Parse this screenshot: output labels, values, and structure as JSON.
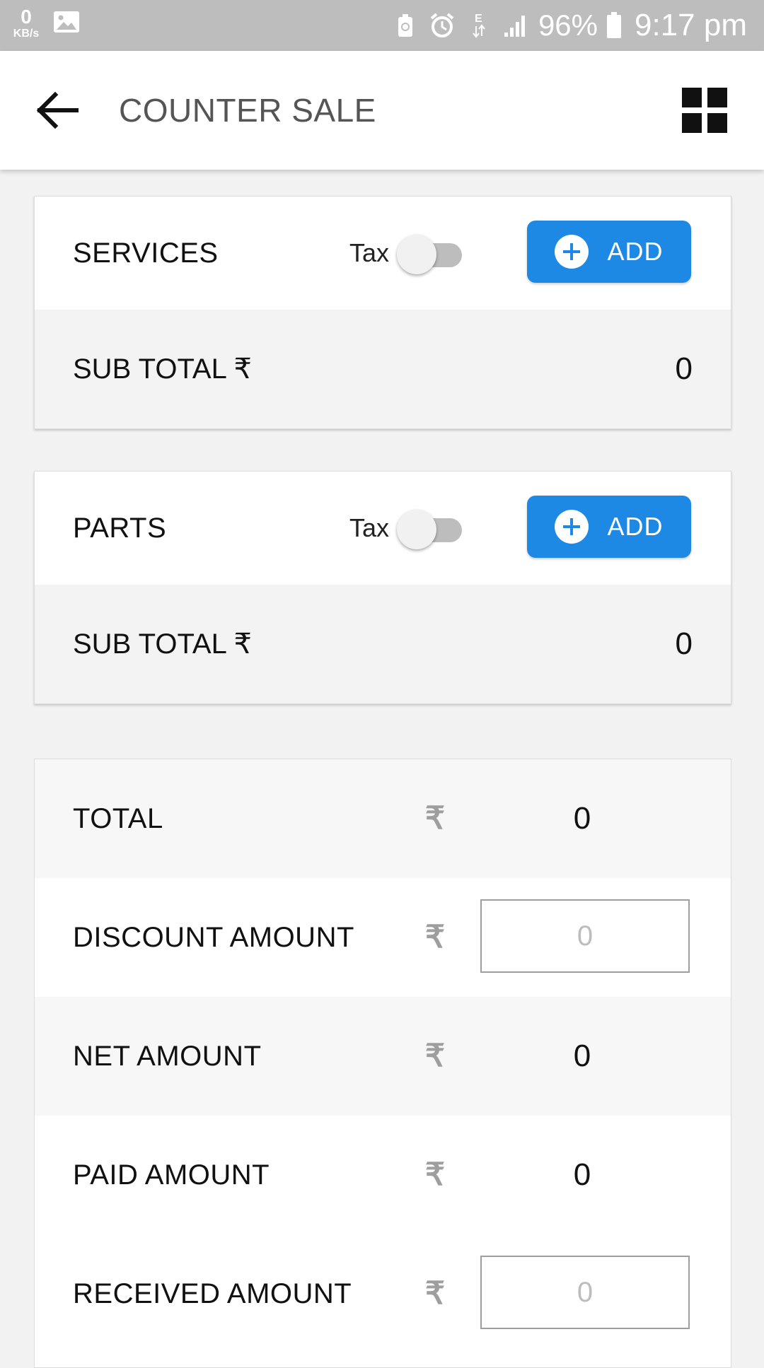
{
  "status_bar": {
    "kbps_value": "0",
    "kbps_unit": "KB/s",
    "battery_percent": "96%",
    "time": "9:17 pm"
  },
  "app_bar": {
    "title": "COUNTER SALE"
  },
  "services_card": {
    "title": "SERVICES",
    "tax_label": "Tax",
    "tax_enabled": false,
    "add_label": "ADD",
    "subtotal_label": "SUB TOTAL ₹",
    "subtotal_value": "0"
  },
  "parts_card": {
    "title": "PARTS",
    "tax_label": "Tax",
    "tax_enabled": false,
    "add_label": "ADD",
    "subtotal_label": "SUB TOTAL ₹",
    "subtotal_value": "0"
  },
  "summary": {
    "currency_symbol": "₹",
    "total_label": "TOTAL",
    "total_value": "0",
    "discount_label": "DISCOUNT AMOUNT",
    "discount_placeholder": "0",
    "net_label": "NET AMOUNT",
    "net_value": "0",
    "paid_label": "PAID AMOUNT",
    "paid_value": "0",
    "received_label": "RECEIVED AMOUNT",
    "received_placeholder": "0"
  },
  "colors": {
    "accent": "#1e88e5",
    "status_bar": "#bdbdbd",
    "background": "#f2f2f2"
  }
}
